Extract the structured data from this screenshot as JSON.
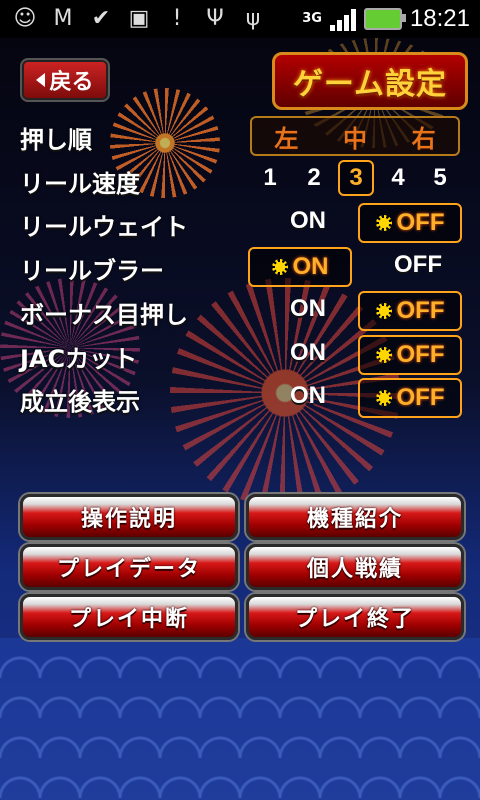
{
  "status_bar": {
    "network": "3G",
    "time": "18:21",
    "icons": [
      "message-icon",
      "gmail-icon",
      "download-done-icon",
      "shopping-bag-icon",
      "alert-icon",
      "usb-icon",
      "usb-debug-icon"
    ]
  },
  "header": {
    "back_label": "戻る",
    "title": "ゲーム設定"
  },
  "settings": {
    "push_order": {
      "label": "押し順",
      "options": [
        "左",
        "中",
        "右"
      ]
    },
    "reel_speed": {
      "label": "リール速度",
      "options": [
        "1",
        "2",
        "3",
        "4",
        "5"
      ],
      "selected": "3"
    },
    "reel_wait": {
      "label": "リールウェイト",
      "on": "ON",
      "off": "OFF",
      "selected": "OFF"
    },
    "reel_blur": {
      "label": "リールブラー",
      "on": "ON",
      "off": "OFF",
      "selected": "ON"
    },
    "bonus_eye": {
      "label": "ボーナス目押し",
      "on": "ON",
      "off": "OFF",
      "selected": "OFF"
    },
    "jac_cut": {
      "label": "JACカット",
      "on": "ON",
      "off": "OFF",
      "selected": "OFF"
    },
    "win_display": {
      "label": "成立後表示",
      "on": "ON",
      "off": "OFF",
      "selected": "OFF"
    }
  },
  "menu": {
    "manual": "操作説明",
    "machine_info": "機種紹介",
    "play_data": "プレイデータ",
    "personal_record": "個人戦績",
    "suspend": "プレイ中断",
    "quit": "プレイ終了"
  },
  "colors": {
    "accent_orange": "#ffa41a",
    "button_red": "#d81818",
    "title_yellow": "#ffd23a"
  }
}
